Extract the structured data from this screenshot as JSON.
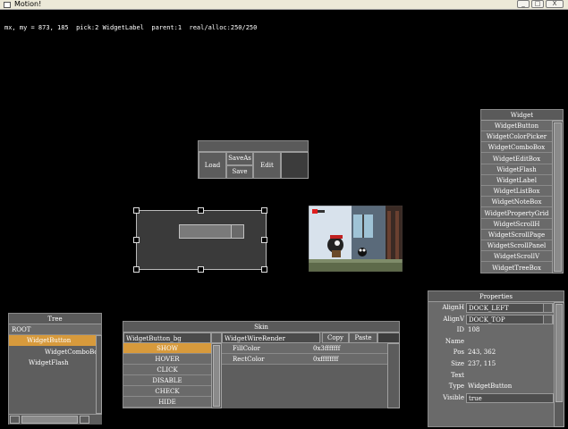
{
  "window": {
    "title": "Motion!",
    "minimize_glyph": "_",
    "maximize_glyph": "□",
    "close_glyph": "X"
  },
  "status_line": "mx, my = 873, 185  pick:2 WidgetLabel  parent:1  real/alloc:250/250",
  "toolbar_panel": {
    "load": "Load",
    "saveas": "SaveAs",
    "save": "Save",
    "edit": "Edit"
  },
  "widget_panel": {
    "title": "Widget",
    "items": [
      "WidgetButton",
      "WidgetColorPicker",
      "WidgetComboBox",
      "WidgetEditBox",
      "WidgetFlash",
      "WidgetLabel",
      "WidgetListBox",
      "WidgetNoteBox",
      "WidgetPropertyGrid",
      "WidgetScrollH",
      "WidgetScrollPage",
      "WidgetScrollPanel",
      "WidgetScrollV",
      "WidgetTreeBox"
    ]
  },
  "tree_panel": {
    "title": "Tree",
    "root": "ROOT",
    "items": [
      {
        "label": "WidgetButton",
        "selected": true
      },
      {
        "label": "WidgetComboBo",
        "selected": false
      },
      {
        "label": "WidgetFlash",
        "selected": false
      }
    ]
  },
  "skin_panel": {
    "title": "Skin",
    "left_name": "WidgetButton_bg",
    "right_name": "WidgetWireRender",
    "copy": "Copy",
    "paste": "Paste",
    "states": [
      "SHOW",
      "HOVER",
      "CLICK",
      "DISABLE",
      "CHECK",
      "HIDE"
    ],
    "selected_state": "SHOW",
    "colors": [
      {
        "name": "FillColor",
        "value": "0x3fffffff"
      },
      {
        "name": "RectColor",
        "value": "0xffffffff"
      }
    ]
  },
  "properties_panel": {
    "title": "Properties",
    "rows": [
      {
        "label": "AlignH",
        "value": "DOCK_LEFT"
      },
      {
        "label": "AlignV",
        "value": "DOCK_TOP"
      },
      {
        "label": "ID",
        "value": "108"
      },
      {
        "label": "Name",
        "value": ""
      },
      {
        "label": "Pos",
        "value": "243, 362"
      },
      {
        "label": "Size",
        "value": "237, 115"
      },
      {
        "label": "Text",
        "value": ""
      },
      {
        "label": "Type",
        "value": "WidgetButton"
      },
      {
        "label": "Visible",
        "value": "true"
      }
    ]
  },
  "colors": {
    "selection": "#d79a3c",
    "panel": "#6a6a6a",
    "header": "#5a5a5a"
  }
}
